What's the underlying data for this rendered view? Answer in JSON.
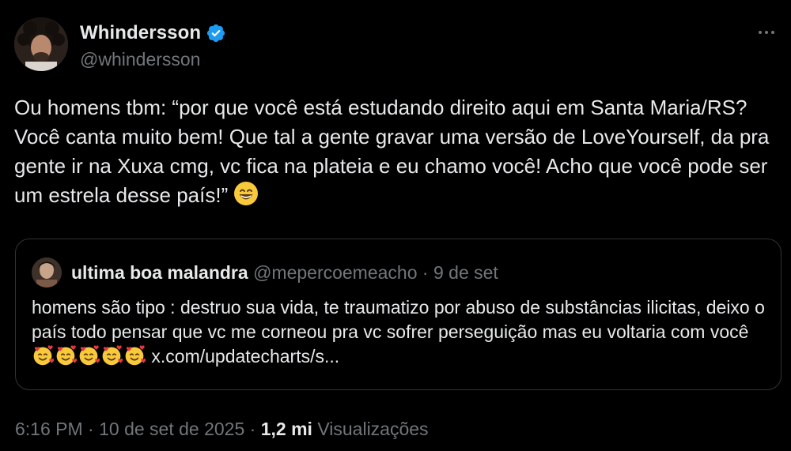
{
  "colors": {
    "background": "#000000",
    "text_primary": "#e7e9ea",
    "text_secondary": "#71767b",
    "verified_blue": "#1d9bf0",
    "border": "#2f3336"
  },
  "tweet": {
    "author": {
      "display_name": "Whindersson",
      "handle": "@whindersson",
      "verified": true
    },
    "text": "Ou homens tbm: “por que você está estudando direito aqui em Santa Maria/RS? Você canta muito bem! Que tal a gente gravar uma versão de LoveYourself, da pra gente ir na Xuxa cmg, vc fica na plateia e eu chamo você! Acho que você pode ser um estrela desse país!” ",
    "trailing_emoji": "grinning-face-smiling-eyes",
    "quote": {
      "display_name": "ultima boa malandra",
      "handle": "@mepercoemeacho",
      "separator": "·",
      "date": "9 de set",
      "text": "homens são tipo : destruo sua vida, te traumatizo por abuso de substâncias ilicitas, deixo o país todo pensar que vc me corneou pra vc sofrer perseguição mas eu voltaria com você",
      "emojis": [
        "smiling-face-with-hearts",
        "smiling-face-with-hearts",
        "smiling-face-with-hearts",
        "smiling-face-with-hearts",
        "smiling-face-with-hearts"
      ],
      "link": "x.com/updatecharts/s..."
    },
    "meta": {
      "time": "6:16 PM",
      "sep1": "·",
      "date": "10 de set de 2025",
      "sep2": "·",
      "views_count": "1,2 mi",
      "views_label": "Visualizações"
    },
    "icons": {
      "more": "more-horizontal-icon",
      "verified": "verified-badge-icon"
    }
  }
}
